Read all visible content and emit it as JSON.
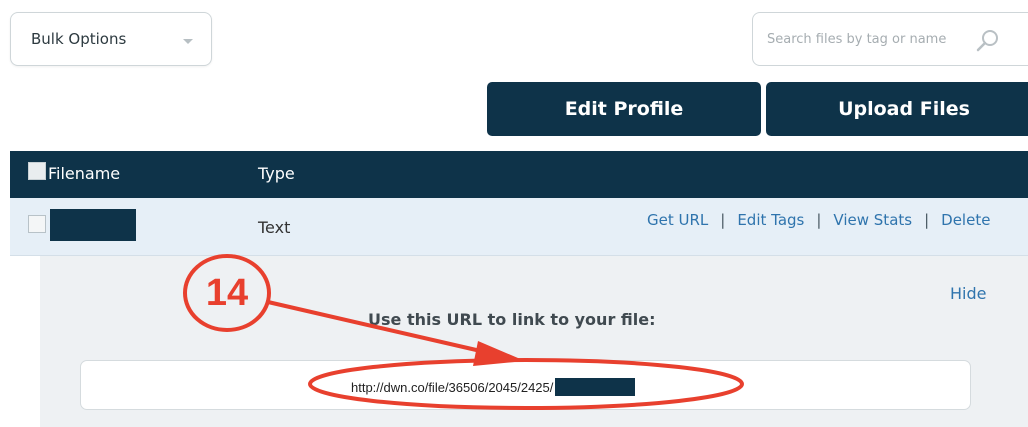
{
  "toolbar": {
    "bulk_options_label": "Bulk Options",
    "search_placeholder": "Search files by tag or name"
  },
  "buttons": {
    "edit_profile": "Edit Profile",
    "upload_files": "Upload Files"
  },
  "table": {
    "columns": [
      "Filename",
      "Type"
    ],
    "rows": [
      {
        "filename": "",
        "type": "Text",
        "actions": [
          "Get URL",
          "Edit Tags",
          "View Stats",
          "Delete"
        ]
      }
    ]
  },
  "url_panel": {
    "hide_label": "Hide",
    "instruction": "Use this URL to link to your file:",
    "url_prefix": "http://dwn.co/file/36506/2045/2425/"
  },
  "annotation": {
    "step_number": "14",
    "color": "#e8402e"
  },
  "colors": {
    "primary": "#0e3349",
    "link": "#2f74ad",
    "row_highlight": "#e6eff7",
    "panel_bg": "#eef1f3"
  }
}
